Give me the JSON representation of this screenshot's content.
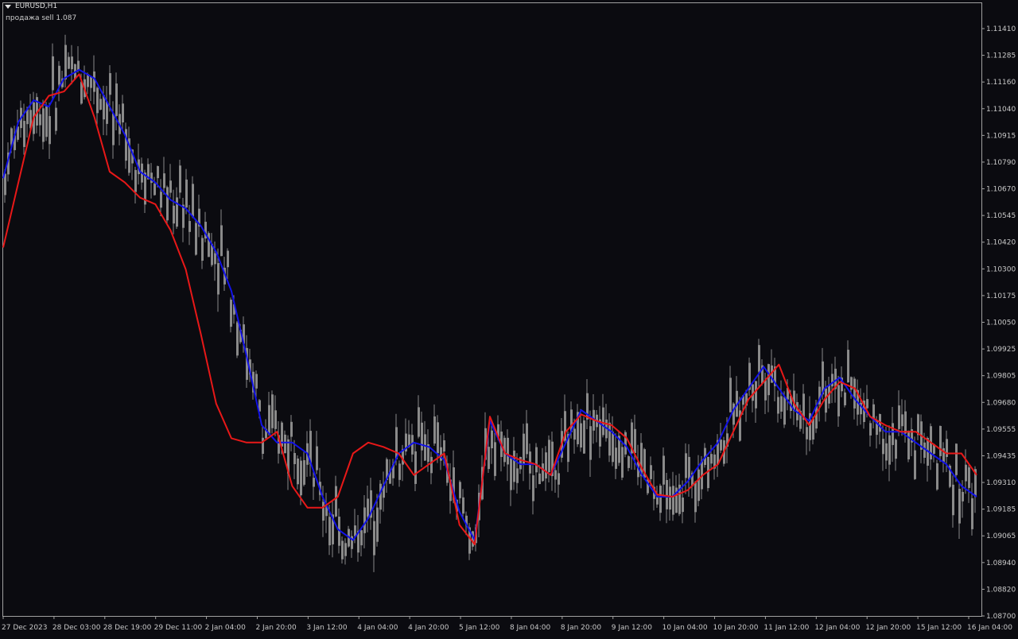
{
  "header": {
    "symbol_label": "EURUSD,H1",
    "indicator_label": "продажа sell 1.087"
  },
  "colors": {
    "background": "#0b0b10",
    "candle": "#8a8a8a",
    "blue_line": "#1212e8",
    "red_line": "#e81818",
    "axis_text": "#c8c8c8",
    "frame": "#a0a0a0"
  },
  "chart_data": {
    "type": "line",
    "y_axis_ticks": [
      "1.11410",
      "1.11285",
      "1.11160",
      "1.11040",
      "1.10915",
      "1.10790",
      "1.10670",
      "1.10545",
      "1.10420",
      "1.10300",
      "1.10175",
      "1.10050",
      "1.09925",
      "1.09805",
      "1.09680",
      "1.09555",
      "1.09435",
      "1.09310",
      "1.09185",
      "1.09065",
      "1.08940",
      "1.08820",
      "1.08700"
    ],
    "x_axis_ticks": [
      "27 Dec 2023",
      "28 Dec 03:00",
      "28 Dec 19:00",
      "29 Dec 11:00",
      "2 Jan 04:00",
      "2 Jan 20:00",
      "3 Jan 12:00",
      "4 Jan 04:00",
      "4 Jan 20:00",
      "5 Jan 12:00",
      "8 Jan 04:00",
      "8 Jan 20:00",
      "9 Jan 12:00",
      "10 Jan 04:00",
      "10 Jan 20:00",
      "11 Jan 12:00",
      "12 Jan 04:00",
      "12 Jan 20:00",
      "15 Jan 12:00",
      "16 Jan 04:00"
    ],
    "ylim": [
      1.087,
      1.1141
    ],
    "series": [
      {
        "color": "#1212e8",
        "values": [
          1.1072,
          1.1098,
          1.1108,
          1.1105,
          1.1118,
          1.1122,
          1.1118,
          1.1105,
          1.1092,
          1.1075,
          1.107,
          1.1062,
          1.1058,
          1.105,
          1.1038,
          1.102,
          1.099,
          1.0958,
          1.095,
          1.095,
          1.0945,
          1.0925,
          1.091,
          1.0905,
          1.0915,
          1.093,
          1.0945,
          1.095,
          1.0948,
          1.0942,
          1.0918,
          1.0905,
          1.096,
          1.0945,
          1.094,
          1.094,
          1.0935,
          1.095,
          1.0965,
          1.096,
          1.0955,
          1.0948,
          1.0935,
          1.0925,
          1.0925,
          1.0932,
          1.0942,
          1.095,
          1.0965,
          1.0975,
          1.0985,
          1.0975,
          1.0965,
          1.096,
          1.0975,
          1.098,
          1.097,
          1.0962,
          1.0955,
          1.0955,
          1.095,
          1.0945,
          1.094,
          1.093,
          1.0925
        ]
      },
      {
        "color": "#e81818",
        "values": [
          1.104,
          1.107,
          1.11,
          1.111,
          1.1112,
          1.112,
          1.11,
          1.1075,
          1.107,
          1.1063,
          1.106,
          1.1048,
          1.103,
          1.1,
          1.0968,
          1.0952,
          1.095,
          1.095,
          1.0955,
          1.093,
          1.092,
          1.092,
          1.0925,
          1.0945,
          1.095,
          1.0948,
          1.0945,
          1.0935,
          1.094,
          1.0945,
          1.0912,
          1.0903,
          1.0962,
          1.0945,
          1.0942,
          1.094,
          1.0935,
          1.0955,
          1.0963,
          1.096,
          1.0958,
          1.0952,
          1.0938,
          1.0926,
          1.0925,
          1.0928,
          1.0935,
          1.094,
          1.0955,
          1.097,
          1.0978,
          1.0986,
          1.0968,
          1.0958,
          1.097,
          1.0978,
          1.0975,
          1.0962,
          1.0958,
          1.0955,
          1.0955,
          1.095,
          1.0945,
          1.0945,
          1.0935
        ]
      }
    ]
  }
}
